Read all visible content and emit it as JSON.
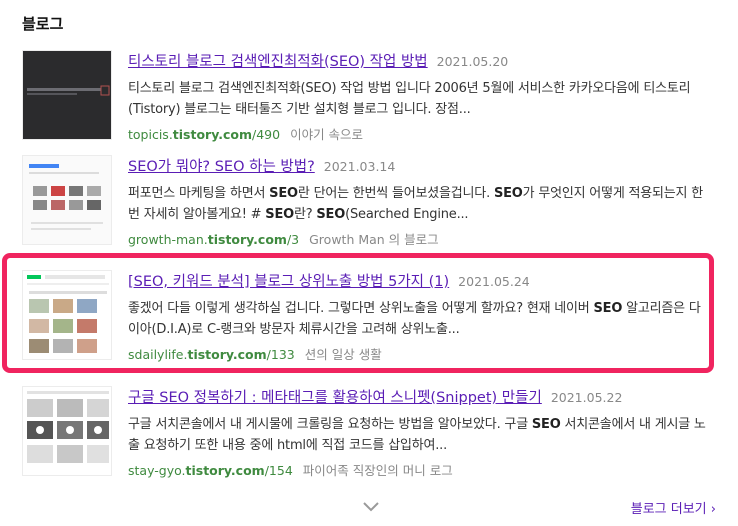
{
  "section": {
    "title": "블로그"
  },
  "results": [
    {
      "title": "티스토리 블로그 검색엔진최적화(SEO) 작업 방법",
      "date": "2021.05.20",
      "desc_html": "티스토리 블로그 검색엔진최적화(SEO) 작업 방법 입니다 2006년 5월에 서비스한 카카오다음에 티스토리(Tistory) 블로그는 태터툴즈 기반 설치형 블로그 입니다. 장점...",
      "url_prefix": "topicis.",
      "url_bold": "tistory.com",
      "url_suffix": "/490",
      "blog": "이야기 속으로",
      "thumb_icon": "dark-code-thumbnail"
    },
    {
      "title": "SEO가 뭐야? SEO 하는 방법?",
      "date": "2021.03.14",
      "desc_html": "퍼포먼스 마케팅을 하면서 <b>SEO</b>란 단어는 한번씩 들어보셨을겁니다. <b>SEO</b>가 무엇인지 어떻게 적용되는지 한번 자세히 알아볼게요! # <b>SEO</b>란? <b>SEO</b>(Searched Engine...",
      "url_prefix": "growth-man.",
      "url_bold": "tistory.com",
      "url_suffix": "/3",
      "blog": "Growth Man 의 블로그",
      "thumb_icon": "search-results-thumbnail"
    },
    {
      "title": "[SEO, 키워드 분석] 블로그 상위노출 방법 5가지 (1)",
      "date": "2021.05.24",
      "desc_html": "좋겠어 다들 이렇게 생각하실 겁니다. 그렇다면 상위노출을 어떻게 할까요? 현재 네이버 <b>SEO</b> 알고리즘은 다이아(D.I.A)로 C-랭크와 방문자 체류시간을 고려해 상위노출...",
      "url_prefix": "sdailylife.",
      "url_bold": "tistory.com",
      "url_suffix": "/133",
      "blog": "션의 일상 생활",
      "thumb_icon": "naver-search-thumbnail"
    },
    {
      "title": "구글 SEO 정복하기 : 메타태그를 활용하여 스니펫(Snippet) 만들기",
      "date": "2021.05.22",
      "desc_html": "구글 서치콘솔에서 내 게시물에 크롤링을 요청하는 방법을 알아보았다. 구글 <b>SEO</b> 서치콘솔에서 내 게시글 노출 요청하기 또한 내용 중에 html에 직접 코드를 삽입하여...",
      "url_prefix": "stay-gyo.",
      "url_bold": "tistory.com",
      "url_suffix": "/154",
      "blog": "파이어족 직장인의 머니 로그",
      "thumb_icon": "video-grid-thumbnail"
    }
  ],
  "footer": {
    "more_label": "블로그 더보기",
    "more_chevron": "›",
    "expand_icon": "chevron-down-icon"
  },
  "colors": {
    "title": "#5a1db5",
    "url": "#3f8a3f",
    "highlight": "#f0245f"
  }
}
